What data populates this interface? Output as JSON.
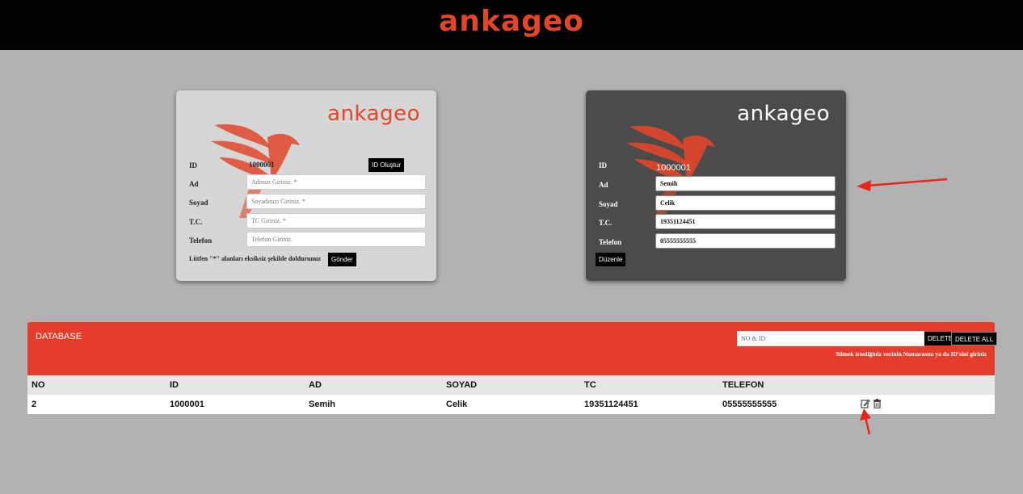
{
  "header": {
    "logo_text": "ankageo"
  },
  "form_card": {
    "logo_text": "ankageo",
    "labels": {
      "id": "ID",
      "ad": "Ad",
      "soyad": "Soyad",
      "tc": "T.C.",
      "telefon": "Telefon"
    },
    "id_value": "1000001",
    "generate_id_button": "ID Oluştur",
    "placeholders": {
      "ad": "Adınızı Giriniz. *",
      "soyad": "Soyadınızı Giriniz. *",
      "tc": "TC Giriniz. *",
      "telefon": "Telefon Giriniz."
    },
    "note": "Lütfen \"*\" alanları eksiksiz şekilde doldurunuz",
    "submit_button": "Gönder"
  },
  "edit_card": {
    "logo_text": "ankageo",
    "labels": {
      "id": "ID",
      "ad": "Ad",
      "soyad": "Soyad",
      "tc": "T.C.",
      "telefon": "Telefon"
    },
    "id_value": "1000001",
    "values": {
      "ad": "Semih",
      "soyad": "Celik",
      "tc": "19351124451",
      "telefon": "05555555555"
    },
    "edit_button": "Düzenle"
  },
  "database": {
    "title": "DATABASE",
    "search_placeholder": "NO & ID",
    "delete_button": "DELETE",
    "delete_all_button": "DELETE ALL",
    "hint": "Silmek istediğiniz verinin Numarasını ya da ID'sini giriniz",
    "columns": [
      "NO",
      "ID",
      "AD",
      "SOYAD",
      "TC",
      "TELEFON"
    ],
    "rows": [
      [
        "2",
        "1000001",
        "Semih",
        "Celik",
        "19351124451",
        "05555555555"
      ]
    ]
  },
  "colors": {
    "brand_orange": "#e2462a",
    "db_header_red": "#e43d2b",
    "annotation_arrow": "#e8261c"
  },
  "icons": [
    "edit-icon",
    "trash-icon",
    "phoenix-logo"
  ]
}
